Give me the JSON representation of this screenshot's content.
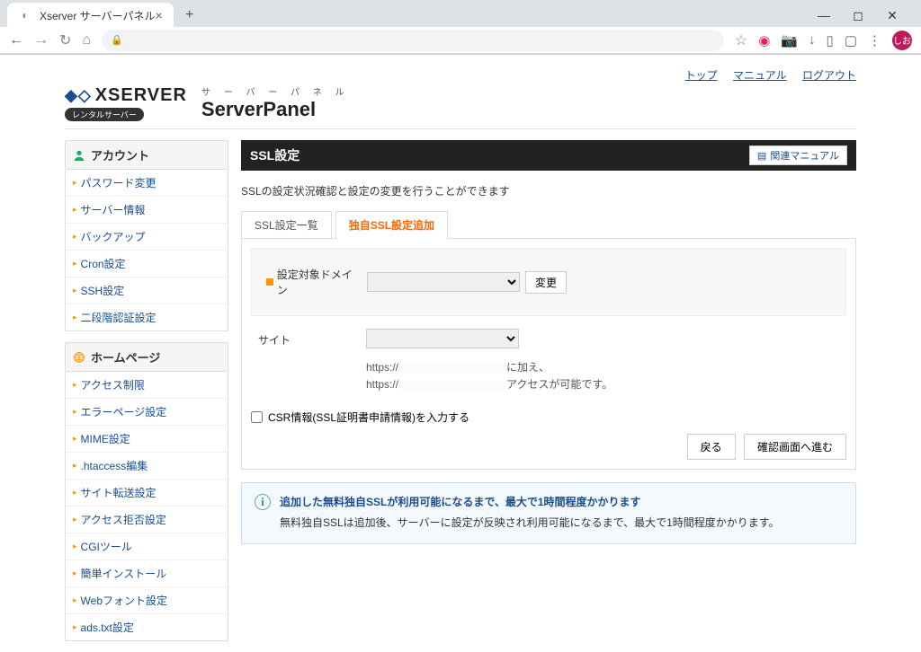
{
  "browser": {
    "tab_title": "Xserver サーバーパネル",
    "window": {
      "min": "—",
      "max": "◻",
      "close": "✕"
    }
  },
  "top_links": {
    "top": "トップ",
    "manual": "マニュアル",
    "logout": "ログアウト"
  },
  "logo": {
    "text": "XSERVER",
    "badge": "レンタルサーバー",
    "panel_sub": "サ ー バ ー パ ネ ル",
    "panel_main": "ServerPanel"
  },
  "sidebar": {
    "account": {
      "title": "アカウント",
      "items": [
        "パスワード変更",
        "サーバー情報",
        "バックアップ",
        "Cron設定",
        "SSH設定",
        "二段階認証設定"
      ]
    },
    "homepage": {
      "title": "ホームページ",
      "items": [
        "アクセス制限",
        "エラーページ設定",
        "MIME設定",
        ".htaccess編集",
        "サイト転送設定",
        "アクセス拒否設定",
        "CGIツール",
        "簡単インストール",
        "Webフォント設定",
        "ads.txt設定"
      ]
    }
  },
  "main": {
    "title": "SSL設定",
    "manual_link": "関連マニュアル",
    "desc": "SSLの設定状況確認と設定の変更を行うことができます",
    "tabs": {
      "list": "SSL設定一覧",
      "add": "独自SSL設定追加"
    },
    "form": {
      "domain_label": "設定対象ドメイン",
      "change_btn": "変更",
      "site_label": "サイト",
      "url_prefix": "https://",
      "url_suffix1": "に加え、",
      "url_suffix2": "アクセスが可能です。",
      "csr_label": "CSR情報(SSL証明書申請情報)を入力する",
      "back_btn": "戻る",
      "confirm_btn": "確認画面へ進む"
    },
    "info": {
      "title": "追加した無料独自SSLが利用可能になるまで、最大で1時間程度かかります",
      "text": "無料独自SSLは追加後、サーバーに設定が反映され利用可能になるまで、最大で1時間程度かかります。"
    }
  }
}
